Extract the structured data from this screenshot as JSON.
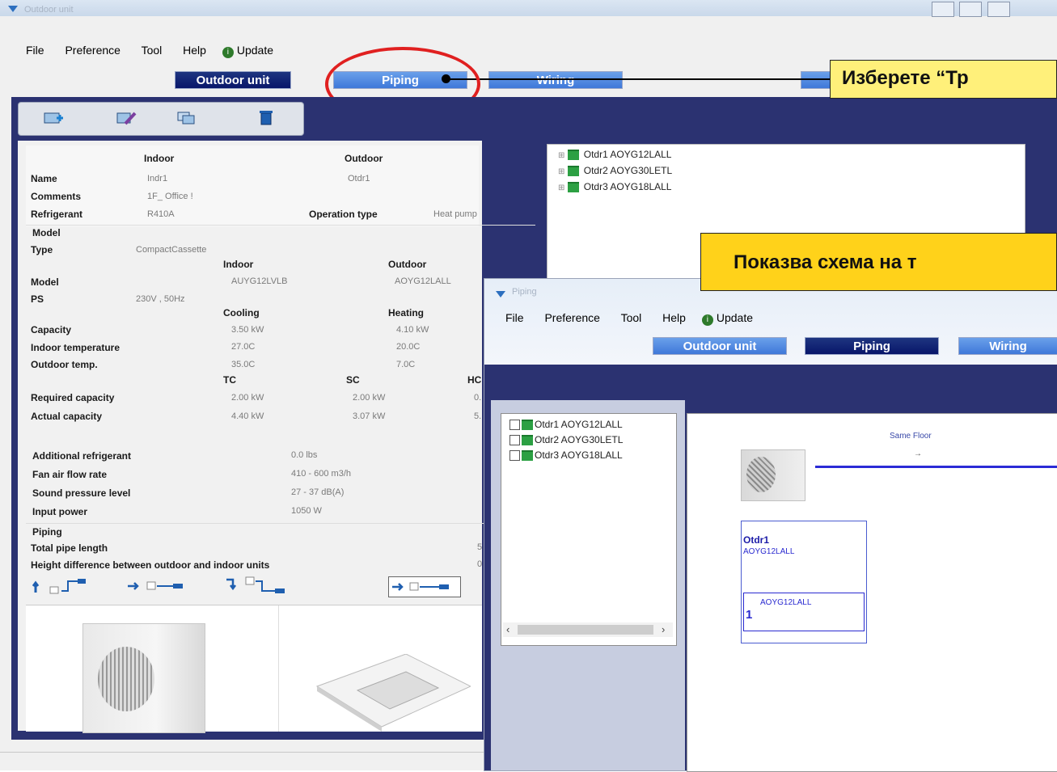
{
  "back_window": {
    "title": "Outdoor unit",
    "menu": [
      "File",
      "Preference",
      "Tool",
      "Help",
      "Update"
    ],
    "nav": [
      "Outdoor unit",
      "Piping",
      "Wiring"
    ],
    "details": {
      "col_indoor": "Indoor",
      "col_outdoor": "Outdoor",
      "name_label": "Name",
      "name_indoor": "Indr1",
      "name_outdoor": "Otdr1",
      "comments_label": "Comments",
      "comments_value": "1F_ Office !",
      "refrigerant_label": "Refrigerant",
      "refrigerant_value": "R410A",
      "optype_label": "Operation type",
      "optype_value": "Heat pump",
      "model_section": "Model",
      "type_label": "Type",
      "type_value": "CompactCassette",
      "model_indoor_head": "Indoor",
      "model_outdoor_head": "Outdoor",
      "model_label": "Model",
      "model_indoor": "AUYG12LVLB",
      "model_outdoor": "AOYG12LALL",
      "ps_label": "PS",
      "ps_value": "230V , 50Hz",
      "cooling_head": "Cooling",
      "heating_head": "Heating",
      "capacity_label": "Capacity",
      "capacity_cool": "3.50 kW",
      "capacity_heat": "4.10 kW",
      "indoor_temp_label": "Indoor temperature",
      "indoor_temp_cool": "27.0C",
      "indoor_temp_heat": "20.0C",
      "outdoor_temp_label": "Outdoor temp.",
      "outdoor_temp_cool": "35.0C",
      "outdoor_temp_heat": "7.0C",
      "tc_head": "TC",
      "sc_head": "SC",
      "hc_head": "HC",
      "req_cap_label": "Required capacity",
      "req_cap_tc": "2.00 kW",
      "req_cap_sc": "2.00 kW",
      "req_cap_hc": "0.",
      "act_cap_label": "Actual capacity",
      "act_cap_tc": "4.40 kW",
      "act_cap_sc": "3.07 kW",
      "act_cap_hc": "5.",
      "add_ref_label": "Additional refrigerant",
      "add_ref_value": "0.0 lbs",
      "fan_label": "Fan air flow rate",
      "fan_value": "410 - 600 m3/h",
      "sound_label": "Sound pressure level",
      "sound_value": "27 - 37 dB(A)",
      "input_label": "Input power",
      "input_value": "1050 W",
      "piping_section": "Piping",
      "pipe_len_label": "Total pipe length",
      "pipe_len_value": "5",
      "height_label": "Height difference between outdoor and indoor units",
      "height_value": "0"
    },
    "tree": [
      "Otdr1  AOYG12LALL",
      "Otdr2  AOYG30LETL",
      "Otdr3  AOYG18LALL"
    ]
  },
  "front_window": {
    "title": "Piping",
    "menu": [
      "File",
      "Preference",
      "Tool",
      "Help",
      "Update"
    ],
    "nav": [
      "Outdoor unit",
      "Piping",
      "Wiring"
    ],
    "tree": [
      "Otdr1 AOYG12LALL",
      "Otdr2 AOYG30LETL",
      "Otdr3 AOYG18LALL"
    ],
    "diagram": {
      "floor_label": "Same Floor",
      "unit_name": "Otdr1",
      "unit_model": "AOYG12LALL",
      "indoor_model": "AOYG12LALL",
      "indoor_index": "1"
    }
  },
  "callouts": {
    "top": "Изберете “Тр",
    "middle": "Показва схема на т"
  },
  "colors": {
    "nav_dark": "#08166a",
    "nav_light": "#3f78d9",
    "callout": "#fff07a",
    "highlight_ring": "#e02020"
  }
}
